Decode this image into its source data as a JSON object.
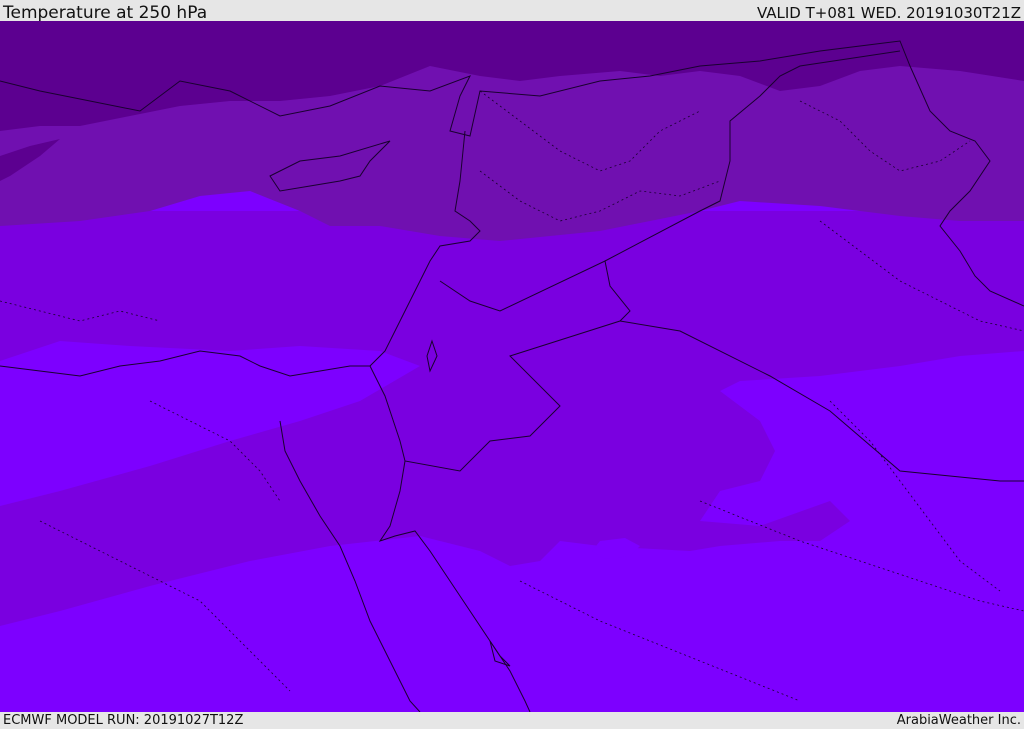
{
  "header": {
    "title": "Temperature at 250 hPa",
    "valid_time": "VALID T+081 WED. 20191030T21Z"
  },
  "footer": {
    "model_run": "ECMWF MODEL RUN: 20191027T12Z",
    "credit": "ArabiaWeather Inc."
  },
  "map": {
    "colors": {
      "coldest_band": "#5c0090",
      "cold_band": "#7010b0",
      "mid_band": "#7a00e0",
      "warm_band": "#7d00ff",
      "border_line": "#1a0030"
    },
    "shading_bands": [
      "coldest-band",
      "cold-band",
      "mid-band",
      "warm-band"
    ]
  }
}
